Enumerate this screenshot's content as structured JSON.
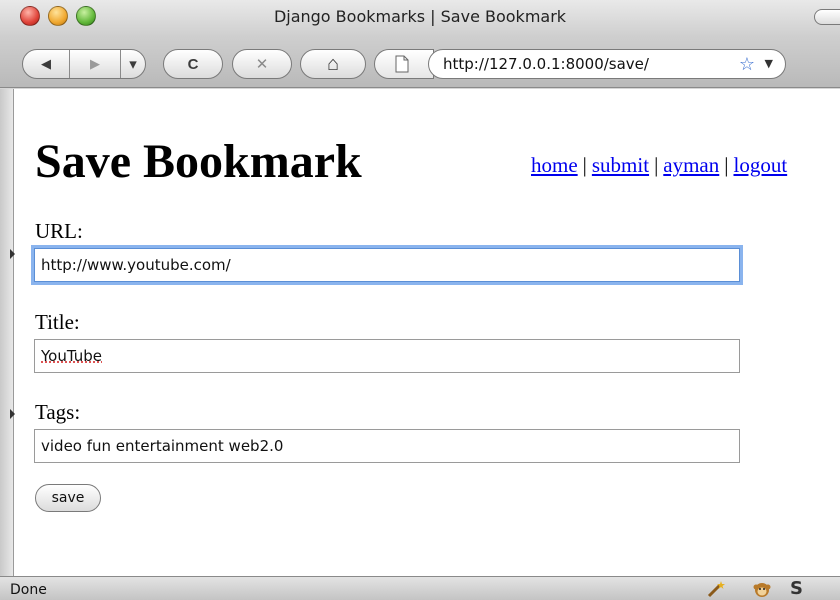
{
  "window": {
    "title": "Django Bookmarks | Save Bookmark"
  },
  "toolbar": {
    "back_glyph": "◀",
    "forward_glyph": "▶",
    "history_glyph": "▾",
    "reload_glyph": "C",
    "stop_glyph": "✕",
    "home_glyph": "⌂",
    "url": "http://127.0.0.1:8000/save/",
    "bookmark_star_glyph": "☆",
    "url_dropdown_glyph": "▼"
  },
  "page": {
    "title": "Save Bookmark",
    "nav": [
      {
        "label": "home"
      },
      {
        "label": "submit"
      },
      {
        "label": "ayman"
      },
      {
        "label": "logout"
      }
    ],
    "nav_separator": "|",
    "form": {
      "url_label": "URL:",
      "url_value": "http://www.youtube.com/",
      "title_label": "Title:",
      "title_value": "YouTube",
      "tags_label": "Tags:",
      "tags_value": "video fun entertainment web2.0",
      "save_label": "save"
    }
  },
  "statusbar": {
    "text": "Done",
    "icons": [
      "wand-icon",
      "monkey-icon",
      "s-icon"
    ],
    "s_glyph": "S"
  },
  "colors": {
    "link": "#0000ee",
    "focus_ring": "#8ab4ee"
  }
}
